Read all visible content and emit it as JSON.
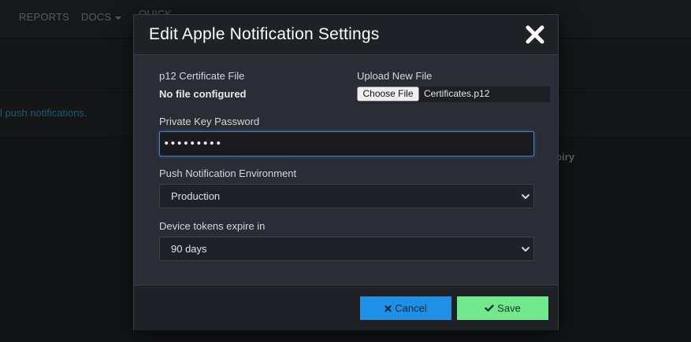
{
  "background": {
    "nav": {
      "reports": "REPORTS",
      "docs": "DOCS",
      "quick": "QUICK"
    },
    "info_text": "l push notifications.",
    "column_text": "xpiry"
  },
  "modal": {
    "title": "Edit Apple Notification Settings",
    "close_icon": "close-icon",
    "certificate": {
      "label": "p12 Certificate File",
      "value": "No file configured"
    },
    "upload": {
      "label": "Upload New File",
      "button_label": "Choose File",
      "file_name": "Certificates.p12"
    },
    "password": {
      "label": "Private Key Password",
      "value": "•••••••••"
    },
    "environment": {
      "label": "Push Notification Environment",
      "selected": "Production"
    },
    "expiry": {
      "label": "Device tokens expire in",
      "selected": "90 days"
    },
    "footer": {
      "cancel_label": "Cancel",
      "cancel_icon": "times-icon",
      "save_label": "Save",
      "save_icon": "check-icon"
    }
  },
  "colors": {
    "cancel": "#1e90e6",
    "save": "#72e88f",
    "focus": "#4d7bbf"
  }
}
